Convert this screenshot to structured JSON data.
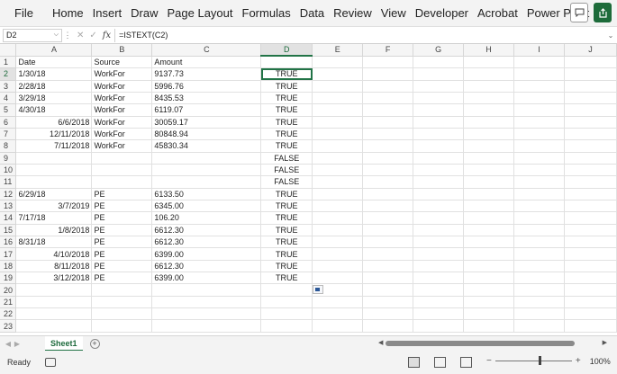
{
  "menu": [
    "File",
    "Home",
    "Insert",
    "Draw",
    "Page Layout",
    "Formulas",
    "Data",
    "Review",
    "View",
    "Developer",
    "Acrobat",
    "Power Pivot"
  ],
  "formula_bar": {
    "name_box": "D2",
    "formula": "=ISTEXT(C2)",
    "fx_label": "fx"
  },
  "columns": [
    "A",
    "B",
    "C",
    "D",
    "E",
    "F",
    "G",
    "H",
    "I",
    "J"
  ],
  "active_column": "D",
  "active_row": 2,
  "rows": [
    {
      "n": "1",
      "A": "Date",
      "A_align": "left",
      "B": "Source",
      "C": "Amount",
      "D": ""
    },
    {
      "n": "2",
      "A": "1/30/18",
      "A_align": "left",
      "B": "WorkFor",
      "C": "9137.73",
      "D": "TRUE"
    },
    {
      "n": "3",
      "A": "2/28/18",
      "A_align": "left",
      "B": "WorkFor",
      "C": "5996.76",
      "D": "TRUE"
    },
    {
      "n": "4",
      "A": "3/29/18",
      "A_align": "left",
      "B": "WorkFor",
      "C": "8435.53",
      "D": "TRUE"
    },
    {
      "n": "5",
      "A": "4/30/18",
      "A_align": "left",
      "B": "WorkFor",
      "C": "6119.07",
      "D": "TRUE"
    },
    {
      "n": "6",
      "A": "6/6/2018",
      "A_align": "right",
      "B": "WorkFor",
      "C": "30059.17",
      "D": "TRUE"
    },
    {
      "n": "7",
      "A": "12/11/2018",
      "A_align": "right",
      "B": "WorkFor",
      "C": "80848.94",
      "D": "TRUE"
    },
    {
      "n": "8",
      "A": "7/11/2018",
      "A_align": "right",
      "B": "WorkFor",
      "C": "45830.34",
      "D": "TRUE"
    },
    {
      "n": "9",
      "A": "",
      "A_align": "left",
      "B": "",
      "C": "",
      "D": "FALSE"
    },
    {
      "n": "10",
      "A": "",
      "A_align": "left",
      "B": "",
      "C": "",
      "D": "FALSE"
    },
    {
      "n": "11",
      "A": "",
      "A_align": "left",
      "B": "",
      "C": "",
      "D": "FALSE"
    },
    {
      "n": "12",
      "A": "6/29/18",
      "A_align": "left",
      "B": "PE",
      "C": "6133.50",
      "D": "TRUE"
    },
    {
      "n": "13",
      "A": "3/7/2019",
      "A_align": "right",
      "B": "PE",
      "C": "6345.00",
      "D": "TRUE"
    },
    {
      "n": "14",
      "A": "7/17/18",
      "A_align": "left",
      "B": "PE",
      "C": "106.20",
      "D": "TRUE"
    },
    {
      "n": "15",
      "A": "1/8/2018",
      "A_align": "right",
      "B": "PE",
      "C": "6612.30",
      "D": "TRUE"
    },
    {
      "n": "16",
      "A": "8/31/18",
      "A_align": "left",
      "B": "PE",
      "C": "6612.30",
      "D": "TRUE"
    },
    {
      "n": "17",
      "A": "4/10/2018",
      "A_align": "right",
      "B": "PE",
      "C": "6399.00",
      "D": "TRUE"
    },
    {
      "n": "18",
      "A": "8/11/2018",
      "A_align": "right",
      "B": "PE",
      "C": "6612.30",
      "D": "TRUE"
    },
    {
      "n": "19",
      "A": "3/12/2018",
      "A_align": "right",
      "B": "PE",
      "C": "6399.00",
      "D": "TRUE"
    },
    {
      "n": "20",
      "A": "",
      "A_align": "left",
      "B": "",
      "C": "",
      "D": ""
    },
    {
      "n": "21",
      "A": "",
      "A_align": "left",
      "B": "",
      "C": "",
      "D": ""
    },
    {
      "n": "22",
      "A": "",
      "A_align": "left",
      "B": "",
      "C": "",
      "D": ""
    },
    {
      "n": "23",
      "A": "",
      "A_align": "left",
      "B": "",
      "C": "",
      "D": ""
    }
  ],
  "sheet_tab": "Sheet1",
  "status": {
    "ready": "Ready",
    "zoom": "100%",
    "zoom_minus": "−",
    "zoom_plus": "+"
  },
  "colors": {
    "accent": "#217346",
    "share": "#1d6b3a"
  },
  "icons": [
    "comment-icon",
    "share-icon",
    "add-sheet-icon",
    "paste-options-icon",
    "normal-view-icon",
    "page-layout-view-icon",
    "page-break-view-icon"
  ]
}
